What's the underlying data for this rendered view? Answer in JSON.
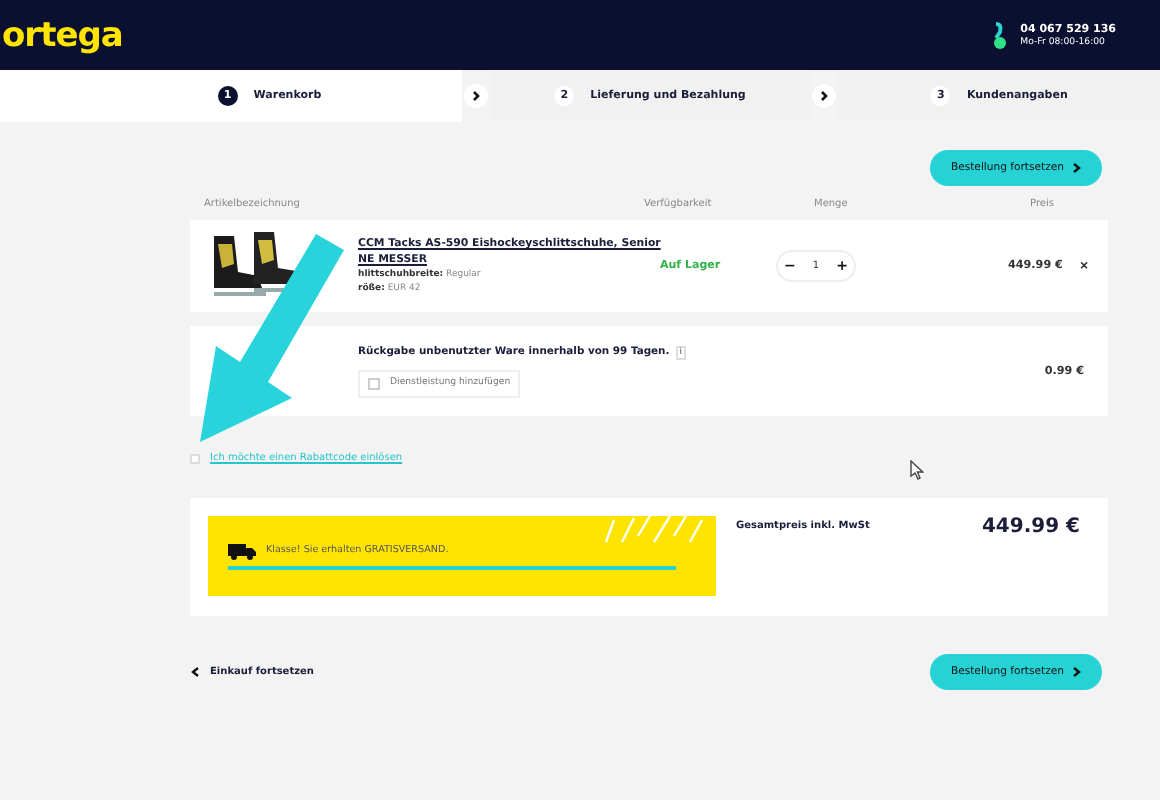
{
  "header": {
    "logo": "ortega",
    "phone": "04 067 529 136",
    "hours": "Mo-Fr 08:00-16:00"
  },
  "steps": [
    {
      "number": "1",
      "label": "Warenkorb",
      "selected": true
    },
    {
      "number": "2",
      "label": "Lieferung und Bezahlung",
      "selected": false
    },
    {
      "number": "3",
      "label": "Kundenangaben",
      "selected": false
    }
  ],
  "top_button": "Bestellung fortsetzen",
  "columns": [
    "Artikelbezeichnung",
    "Verfügbarkeit",
    "Menge",
    "Preis"
  ],
  "product": {
    "title_lines": [
      "CCM Tacks AS-590 Eishockeyschlittschuhe, Senior",
      "NE MESSER"
    ],
    "attributes": [
      {
        "label": "hlittschuhbreite:",
        "value": "Regular"
      },
      {
        "label": "röße:",
        "value": "EUR 42"
      }
    ],
    "availability": "Auf Lager",
    "quantity": "1",
    "minus": "−",
    "plus": "+",
    "price": "449.99 €",
    "remove": "×"
  },
  "service": {
    "title": "Rückgabe unbenutzter Ware innerhalb von 99 Tagen.",
    "info": "i",
    "option_label": "Dienstleistung hinzufügen",
    "checked": false,
    "price": "0.99 €"
  },
  "discount": {
    "label": "Ich möchte einen Rabattcode einlösen",
    "checked": false
  },
  "shipping": {
    "message": "Klasse! Sie erhalten GRATISVERSAND.",
    "level": 1
  },
  "total": {
    "label": "Gesamtpreis inkl. MwSt",
    "value": "449.99 €"
  },
  "back_link": "Einkauf fortsetzen",
  "bottom_button": "Bestellung fortsetzen"
}
